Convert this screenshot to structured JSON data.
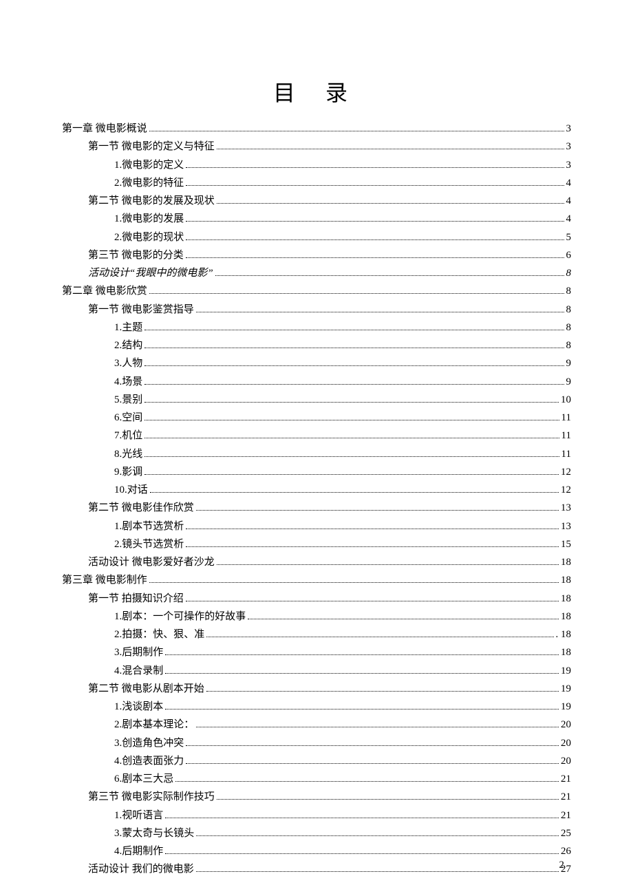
{
  "title": "目  录",
  "pageNumber": "2",
  "entries": [
    {
      "label": "第一章   微电影概说",
      "page": "3",
      "indent": 0,
      "italic": false
    },
    {
      "label": "第一节 微电影的定义与特征",
      "page": "3",
      "indent": 1,
      "italic": false
    },
    {
      "label": "1.微电影的定义",
      "page": "3",
      "indent": 2,
      "italic": false
    },
    {
      "label": "2.微电影的特征",
      "page": "4",
      "indent": 2,
      "italic": false
    },
    {
      "label": "第二节 微电影的发展及现状",
      "page": "4",
      "indent": 1,
      "italic": false
    },
    {
      "label": "1.微电影的发展",
      "page": "4",
      "indent": 2,
      "italic": false
    },
    {
      "label": "2.微电影的现状",
      "page": "5",
      "indent": 2,
      "italic": false
    },
    {
      "label": "第三节 微电影的分类",
      "page": "6",
      "indent": 1,
      "italic": false
    },
    {
      "label": "活动设计“我眼中的微电影”",
      "page": "8",
      "indent": 1,
      "italic": true
    },
    {
      "label": "第二章   微电影欣赏",
      "page": "8",
      "indent": 0,
      "italic": false
    },
    {
      "label": "第一节 微电影鉴赏指导",
      "page": "8",
      "indent": 1,
      "italic": false
    },
    {
      "label": "1.主题",
      "page": "8",
      "indent": 2,
      "italic": false
    },
    {
      "label": "2.结构",
      "page": "8",
      "indent": 2,
      "italic": false
    },
    {
      "label": "3.人物",
      "page": "9",
      "indent": 2,
      "italic": false
    },
    {
      "label": "4.场景",
      "page": "9",
      "indent": 2,
      "italic": false
    },
    {
      "label": "5.景别",
      "page": "10",
      "indent": 2,
      "italic": false
    },
    {
      "label": "6.空间",
      "page": "11",
      "indent": 2,
      "italic": false
    },
    {
      "label": "7.机位",
      "page": "11",
      "indent": 2,
      "italic": false
    },
    {
      "label": "8.光线",
      "page": "11",
      "indent": 2,
      "italic": false
    },
    {
      "label": "9.影调",
      "page": "12",
      "indent": 2,
      "italic": false
    },
    {
      "label": "10.对话",
      "page": "12",
      "indent": 2,
      "italic": false
    },
    {
      "label": "第二节 微电影佳作欣赏",
      "page": "13",
      "indent": 1,
      "italic": false
    },
    {
      "label": "1.剧本节选赏析",
      "page": "13",
      "indent": 2,
      "italic": false
    },
    {
      "label": "2.镜头节选赏析",
      "page": "15",
      "indent": 2,
      "italic": false
    },
    {
      "label": "活动设计 微电影爱好者沙龙",
      "page": "18",
      "indent": 1,
      "italic": false
    },
    {
      "label": "第三章   微电影制作",
      "page": "18",
      "indent": 0,
      "italic": false
    },
    {
      "label": "第一节 拍摄知识介绍",
      "page": "18",
      "indent": 1,
      "italic": false
    },
    {
      "label": "1.剧本：一个可操作的好故事",
      "page": "18",
      "indent": 2,
      "italic": false
    },
    {
      "label": "2.拍摄：快、狠、准",
      "page": ". 18",
      "indent": 2,
      "italic": false
    },
    {
      "label": "3.后期制作",
      "page": "18",
      "indent": 2,
      "italic": false
    },
    {
      "label": "4.混合录制",
      "page": "19",
      "indent": 2,
      "italic": false
    },
    {
      "label": "第二节 微电影从剧本开始",
      "page": "19",
      "indent": 1,
      "italic": false
    },
    {
      "label": "1.浅谈剧本",
      "page": "19",
      "indent": 2,
      "italic": false
    },
    {
      "label": "2.剧本基本理论：",
      "page": "20",
      "indent": 2,
      "italic": false
    },
    {
      "label": "3.创造角色冲突",
      "page": "20",
      "indent": 2,
      "italic": false
    },
    {
      "label": "4.创造表面张力",
      "page": "20",
      "indent": 2,
      "italic": false
    },
    {
      "label": "6.剧本三大忌",
      "page": "21",
      "indent": 2,
      "italic": false
    },
    {
      "label": "第三节 微电影实际制作技巧",
      "page": "21",
      "indent": 1,
      "italic": false
    },
    {
      "label": "1.视听语言",
      "page": "21",
      "indent": 2,
      "italic": false
    },
    {
      "label": "3.蒙太奇与长镜头",
      "page": "25",
      "indent": 2,
      "italic": false
    },
    {
      "label": "4.后期制作",
      "page": "26",
      "indent": 2,
      "italic": false
    },
    {
      "label": "活动设计 我们的微电影",
      "page": "27",
      "indent": 1,
      "italic": false
    }
  ]
}
